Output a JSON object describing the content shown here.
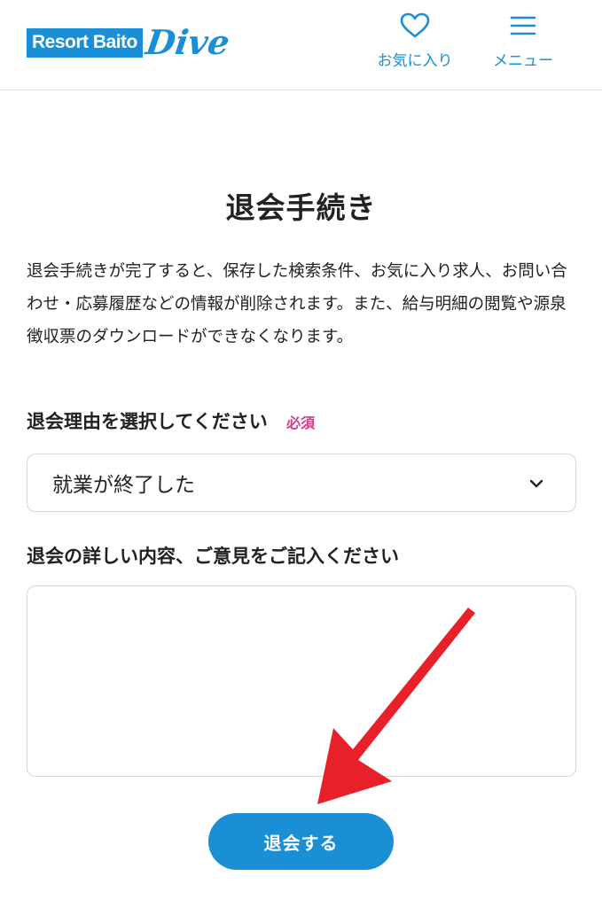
{
  "header": {
    "logo_text": "Resort Baito",
    "logo_script": "Dive",
    "favorites_label": "お気に入り",
    "menu_label": "メニュー",
    "brand_color": "#1a8fd6"
  },
  "main": {
    "title": "退会手続き",
    "description": "退会手続きが完了すると、保存した検索条件、お気に入り求人、お問い合わせ・応募履歴などの情報が削除されます。また、給与明細の閲覧や源泉徴収票のダウンロードができなくなります。",
    "reason_label": "退会理由を選択してください",
    "required_badge": "必須",
    "reason_selected": "就業が終了した",
    "detail_label": "退会の詳しい内容、ご意見をご記入ください",
    "detail_value": "",
    "submit_label": "退会する"
  },
  "icons": {
    "favorites": "heart-icon",
    "menu": "hamburger-menu-icon",
    "select": "chevron-down-icon"
  },
  "colors": {
    "required": "#d63a8c",
    "annotation_arrow": "#e8202a"
  }
}
